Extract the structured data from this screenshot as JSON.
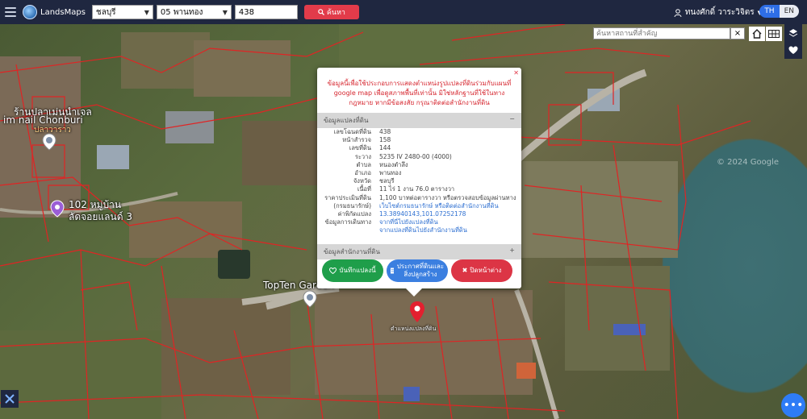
{
  "app": {
    "name": "LandsMaps"
  },
  "search": {
    "province": "ชลบุรี",
    "district": "05 พานทอง",
    "parcel_value": "438",
    "button_label": "ค้นหา"
  },
  "user": {
    "name": "ทนงศักดิ์ วาระวิจิตร"
  },
  "language": {
    "active": "TH",
    "inactive": "EN"
  },
  "place_search": {
    "placeholder": "ค้นหาสถานที่สำคัญ",
    "clear": "×"
  },
  "map": {
    "labels": {
      "shop1": "ร้านปลาเม่นนำเจล",
      "shop2": "im nail Chonburi",
      "shop3": "ปลาวาราว",
      "village1": "102 หมู่บ้าน",
      "village2": "ลัดจอยแลนด์ 3",
      "topten": "TopTen Garden",
      "watermark": "© 2024 Google",
      "marker": "ตำแหน่งแปลงที่ดิน"
    }
  },
  "popup": {
    "close": "✕",
    "note": "ข้อมูลนี้เพื่อใช้ประกอบการแสดงตำแหน่งรูปแปลงที่ดินร่วมกับแผนที่ google map เพื่อดูสภาพพื้นที่เท่านั้น มิใช่หลักฐานที่ใช้ในทางกฎหมาย หากมีข้อสงสัย กรุณาติดต่อสำนักงานที่ดิน",
    "section1": {
      "title": "ข้อมูลแปลงที่ดิน",
      "toggle": "−"
    },
    "rows": [
      {
        "k": "เลขโฉนดที่ดิน",
        "v": "438"
      },
      {
        "k": "หน้าสำรวจ",
        "v": "158"
      },
      {
        "k": "เลขที่ดิน",
        "v": "144"
      },
      {
        "k": "ระวาง",
        "v": "5235 IV 2480-00 (4000)"
      },
      {
        "k": "ตำบล",
        "v": "หนองตำลึง"
      },
      {
        "k": "อำเภอ",
        "v": "พานทอง"
      },
      {
        "k": "จังหวัด",
        "v": "ชลบุรี"
      },
      {
        "k": "เนื้อที่",
        "v": "11 ไร่ 1 งาน 76.0 ตารางวา"
      },
      {
        "k": "ราคาประเมินที่ดิน",
        "v": "1,100 บาทต่อตารางวา หรือตรวจสอบข้อมูลผ่านทาง"
      },
      {
        "k": "(กรมธนารักษ์)",
        "v": "เว็บไซต์กรมธนารักษ์ หรือติดต่อสำนักงานที่ดิน"
      },
      {
        "k": "ค่าพิกัดแปลง",
        "v": "13.38940143,101.07252178"
      },
      {
        "k": "ข้อมูลการเดินทาง",
        "v": "จากที่นี่ไปยังแปลงที่ดิน"
      },
      {
        "k": "",
        "v": "จากแปลงที่ดินไปยังสำนักงานที่ดิน"
      }
    ],
    "section2": {
      "title": "ข้อมูลสำนักงานที่ดิน",
      "toggle": "+"
    },
    "buttons": {
      "save": "บันทึกแปลงนี้",
      "announce": "ประกาศที่ดินและสิ่งปลูกสร้าง",
      "close": "ปิดหน้าต่าง"
    }
  },
  "colors": {
    "accent": "#e23b4a",
    "topbar": "#1f2740",
    "lang_active": "#2e6ee6"
  }
}
